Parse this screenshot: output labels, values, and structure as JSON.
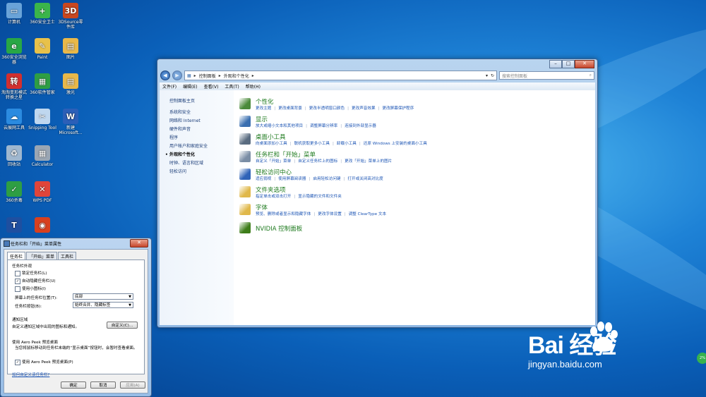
{
  "desktop": {
    "icons": [
      {
        "label": "计算机",
        "glyph": "▭",
        "color": "#6aa3d8"
      },
      {
        "label": "360安全卫士",
        "glyph": "+",
        "color": "#3bb54a"
      },
      {
        "label": "3DSource零件库",
        "glyph": "3D",
        "color": "#c8471f"
      },
      {
        "label": "360安全浏览器",
        "glyph": "e",
        "color": "#28a745"
      },
      {
        "label": "Paint",
        "glyph": "✎",
        "color": "#e8c14a"
      },
      {
        "label": "图片",
        "glyph": "▤",
        "color": "#e8b84a"
      },
      {
        "label": "淘淘变形模式转换之星",
        "glyph": "转",
        "color": "#d32f2f"
      },
      {
        "label": "360软件管家",
        "glyph": "▦",
        "color": "#2e9e44"
      },
      {
        "label": "激光",
        "glyph": "▤",
        "color": "#e8b84a"
      },
      {
        "label": "云展网工具",
        "glyph": "☁",
        "color": "#2b8be0"
      },
      {
        "label": "Snipping Tool",
        "glyph": "✂",
        "color": "#bfd7ef"
      },
      {
        "label": "新建 Microsoft...",
        "glyph": "W",
        "color": "#2b5fb8"
      },
      {
        "label": "回收站",
        "glyph": "♻",
        "color": "#9fb7cf"
      },
      {
        "label": "Calculator",
        "glyph": "▦",
        "color": "#9aa6b4"
      },
      {
        "label": "360杀毒",
        "glyph": "✓",
        "color": "#2e9e44"
      },
      {
        "label": "WPS PDF",
        "glyph": "✕",
        "color": "#e0453a"
      },
      {
        "label": "",
        "glyph": "T",
        "color": "#1e4fa0"
      },
      {
        "label": "",
        "glyph": "◉",
        "color": "#d8401f"
      }
    ]
  },
  "window": {
    "breadcrumb": [
      "控制面板",
      "外观和个性化"
    ],
    "search_placeholder": "搜索控制面板",
    "menu": [
      "文件(F)",
      "编辑(E)",
      "查看(V)",
      "工具(T)",
      "帮助(H)"
    ],
    "sidebar": {
      "home": "控制面板主页",
      "items": [
        "系统和安全",
        "网络和 Internet",
        "硬件和声音",
        "程序",
        "用户帐户和家庭安全",
        "外观和个性化",
        "时钟、语言和区域",
        "轻松访问"
      ],
      "active": "外观和个性化"
    },
    "categories": [
      {
        "title": "个性化",
        "icon": "personalize-icon",
        "color": "#4a8a3a",
        "links": [
          "更改主题",
          "更改桌面背景",
          "更改半透明窗口颜色",
          "更改声音效果",
          "更改屏幕保护程序"
        ]
      },
      {
        "title": "显示",
        "icon": "display-icon",
        "color": "#3a6fb0",
        "links": [
          "放大或缩小文本和其他项目",
          "调整屏幕分辨率",
          "连接到外部显示器"
        ]
      },
      {
        "title": "桌面小工具",
        "icon": "gadgets-icon",
        "color": "#5a6c80",
        "links": [
          "向桌面添加小工具",
          "联机获取更多小工具",
          "卸载小工具",
          "还原 Windows 上安装的桌面小工具"
        ]
      },
      {
        "title": "任务栏和「开始」菜单",
        "icon": "taskbar-icon",
        "color": "#7a8da5",
        "links": [
          "自定义「开始」菜单",
          "自定义任务栏上的图标",
          "更改「开始」菜单上的图片"
        ]
      },
      {
        "title": "轻松访问中心",
        "icon": "ease-of-access-icon",
        "color": "#2f63b8",
        "links": [
          "适应弱视",
          "使用屏幕阅读器",
          "启用轻松访问键",
          "打开或关闭高对比度"
        ]
      },
      {
        "title": "文件夹选项",
        "icon": "folder-options-icon",
        "color": "#e0b84a",
        "links": [
          "指定单击或双击打开",
          "显示隐藏的文件和文件夹"
        ]
      },
      {
        "title": "字体",
        "icon": "fonts-icon",
        "color": "#e0b84a",
        "links": [
          "预览、删除或者显示和隐藏字体",
          "更改字体设置",
          "调整 ClearType 文本"
        ]
      },
      {
        "title": "NVIDIA 控制面板",
        "icon": "nvidia-icon",
        "color": "#3e7d1a",
        "links": []
      }
    ]
  },
  "dialog": {
    "title": "任务栏和「开始」菜单属性",
    "tabs": [
      "任务栏",
      "「开始」菜单",
      "工具栏"
    ],
    "active_tab": "任务栏",
    "appearance_header": "任务栏外观",
    "checkboxes": [
      {
        "label": "锁定任务栏(L)",
        "checked": false
      },
      {
        "label": "自动隐藏任务栏(U)",
        "checked": true
      },
      {
        "label": "使用小图标(I)",
        "checked": false
      }
    ],
    "position_label": "屏幕上的任务栏位置(T):",
    "position_value": "底部",
    "buttons_label": "任务栏按钮(B):",
    "buttons_value": "始终合并、隐藏标签",
    "notify_header": "通知区域",
    "notify_text": "自定义通知区域中出现的图标和通知。",
    "customize_button": "自定义(C)...",
    "peek_header": "使用 Aero Peek 预览桌面",
    "peek_text": "当您将鼠标移动到任务栏末端的“显示桌面”按钮时，会暂时查看桌面。",
    "peek_checkbox": {
      "label": "使用 Aero Peek 预览桌面(P)",
      "checked": true
    },
    "help_link": "如何自定义该任务栏?",
    "ok": "确定",
    "cancel": "取消",
    "apply": "应用(A)"
  },
  "watermark": {
    "logo": "Bai 经验",
    "url": "jingyan.baidu.com"
  },
  "badge_text": "2%"
}
